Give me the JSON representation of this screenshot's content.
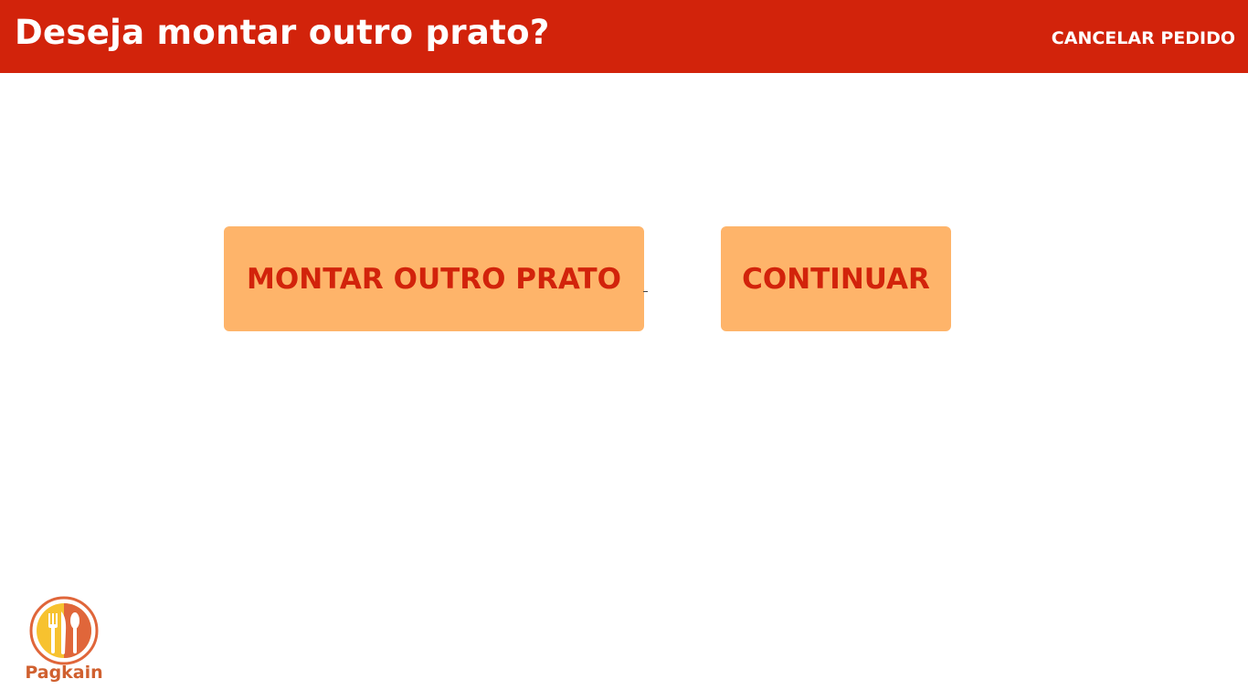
{
  "header": {
    "title": "Deseja montar outro prato?",
    "cancel_label": "CANCELAR PEDIDO"
  },
  "actions": {
    "another_plate_label": "MONTAR OUTRO PRATO",
    "continue_label": "CONTINUAR"
  },
  "brand": {
    "logo_icon": "fork-knife-spoon-icon",
    "name": "Pagkain"
  },
  "colors": {
    "header_bg": "#d2230b",
    "button_bg": "#feb46a",
    "button_text": "#d2230b",
    "logo_ring": "#e0663a",
    "logo_yellow": "#f7c22f"
  }
}
